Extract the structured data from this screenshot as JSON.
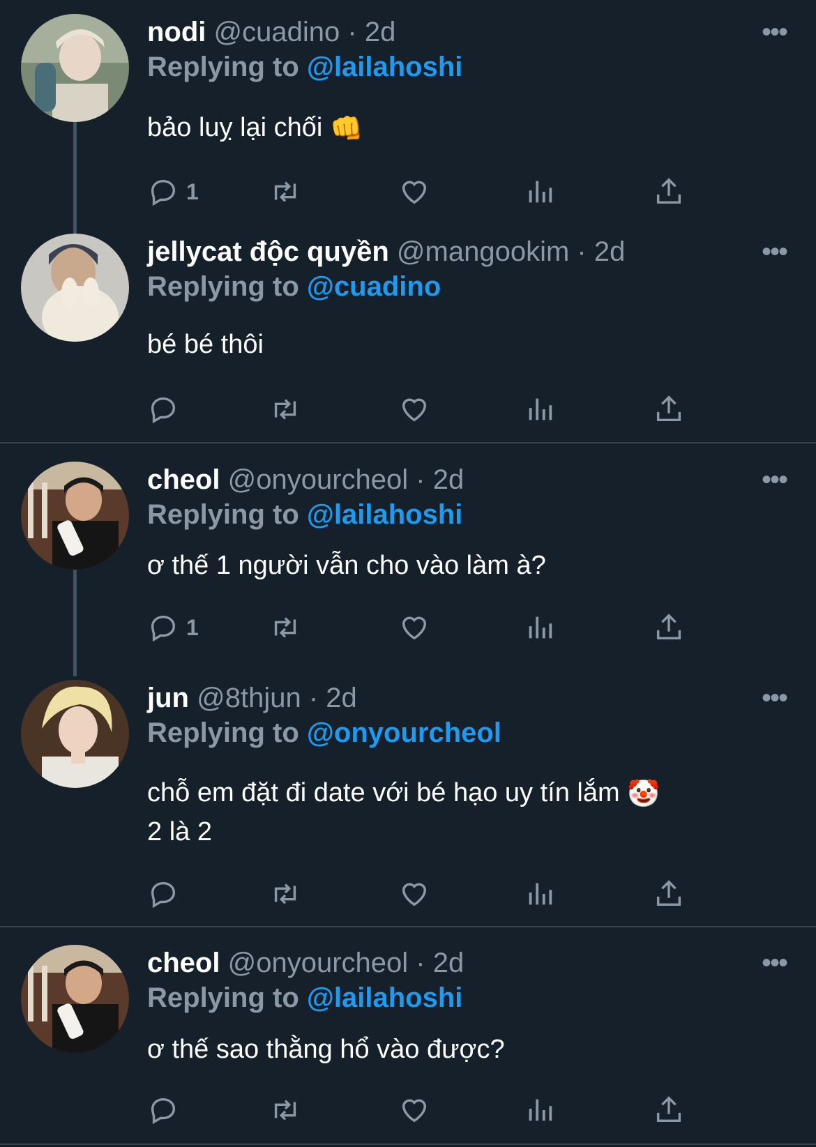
{
  "tweets": [
    {
      "name": "nodi",
      "handle": "@cuadino",
      "time": "2d",
      "reply_prefix": "Replying to",
      "reply_to": "@lailahoshi",
      "text": "bảo luỵ lại chối",
      "emoji": "👊",
      "reply_count": "1"
    },
    {
      "name": "jellycat độc quyền",
      "handle": "@mangookim",
      "time": "2d",
      "reply_prefix": "Replying to",
      "reply_to": "@cuadino",
      "text": "bé bé thôi",
      "reply_count": ""
    },
    {
      "name": "cheol",
      "handle": "@onyourcheol",
      "time": "2d",
      "reply_prefix": "Replying to",
      "reply_to": "@lailahoshi",
      "text": "ơ thế 1 người vẫn cho vào làm à?",
      "reply_count": "1"
    },
    {
      "name": "jun",
      "handle": "@8thjun",
      "time": "2d",
      "reply_prefix": "Replying to",
      "reply_to": "@onyourcheol",
      "text": "chỗ em đặt đi date với bé hạo uy tín lắm",
      "emoji": "🤡",
      "text_line2": "2 là 2",
      "reply_count": ""
    },
    {
      "name": "cheol",
      "handle": "@onyourcheol",
      "time": "2d",
      "reply_prefix": "Replying to",
      "reply_to": "@lailahoshi",
      "text": "ơ thế sao thằng hổ vào được?",
      "reply_count": ""
    }
  ],
  "separator": "·",
  "colors": {
    "background": "#15202b",
    "muted": "#8b98a5",
    "accent": "#1d9bf0",
    "divider": "#38444d"
  },
  "icons": [
    "reply-icon",
    "retweet-icon",
    "like-icon",
    "views-icon",
    "share-icon",
    "more-icon"
  ]
}
